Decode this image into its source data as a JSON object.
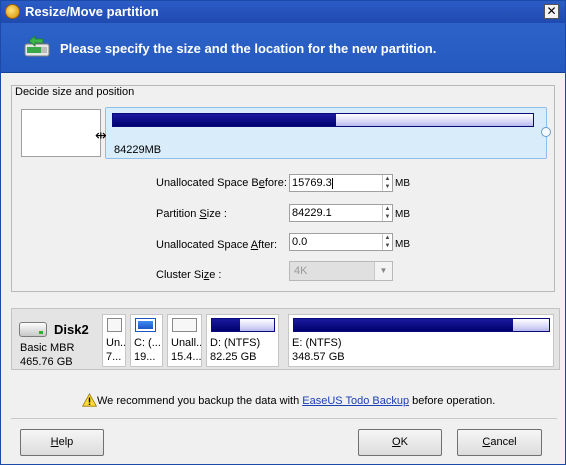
{
  "window": {
    "title": "Resize/Move partition",
    "close_glyph": "✕"
  },
  "banner": {
    "text": "Please specify the size and the location for the new partition.",
    "icon": "partition-resize-icon"
  },
  "section": {
    "legend": "Decide size and position"
  },
  "slider": {
    "partition_label": "84229MB",
    "used_fraction": 0.53
  },
  "form": {
    "before": {
      "label_pre": "Unallocated Space B",
      "label_u": "e",
      "label_post": "fore:",
      "value": "15769.3",
      "unit": "MB"
    },
    "size": {
      "label_pre": "Partition ",
      "label_u": "S",
      "label_post": "ize :",
      "value": "84229.1",
      "unit": "MB"
    },
    "after": {
      "label_pre": "Unallocated Space ",
      "label_u": "A",
      "label_post": "fter:",
      "value": "0.0",
      "unit": "MB"
    },
    "cluster": {
      "label_pre": "Cluster Si",
      "label_u": "z",
      "label_post": "e :",
      "value": "4K"
    }
  },
  "disk": {
    "name": "Disk2",
    "type": "Basic MBR",
    "size": "465.76 GB",
    "partitions": [
      {
        "label": "Un...",
        "size": "7...",
        "kind": "unallocated"
      },
      {
        "label": "C: (...",
        "size": "19...",
        "kind": "selected"
      },
      {
        "label": "Unall...",
        "size": "15.4...",
        "kind": "unallocated"
      },
      {
        "label": "D: (NTFS)",
        "size": "82.25 GB",
        "kind": "ntfs",
        "used_fraction": 0.45
      },
      {
        "label": "E: (NTFS)",
        "size": "348.57 GB",
        "kind": "ntfs",
        "used_fraction": 0.86
      }
    ]
  },
  "warning": {
    "pre": "We recommend you backup the data with ",
    "link": "EaseUS Todo Backup",
    "post": " before operation."
  },
  "buttons": {
    "help": {
      "label_u": "H",
      "label_rest": "elp"
    },
    "ok": {
      "label_u": "O",
      "label_rest": "K"
    },
    "cancel": {
      "label_u": "C",
      "label_rest": "ancel"
    }
  }
}
